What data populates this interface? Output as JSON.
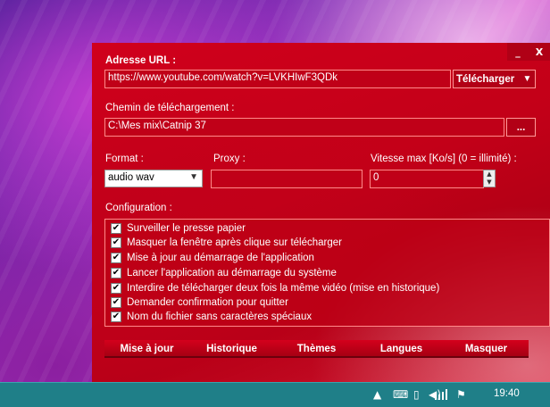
{
  "window": {
    "minimize_label": "_",
    "close_label": "X"
  },
  "url": {
    "label": "Adresse URL :",
    "value": "https://www.youtube.com/watch?v=LVKHIwF3QDk",
    "download_label": "Télécharger",
    "dropdown_arrow": "▼"
  },
  "path": {
    "label": "Chemin de téléchargement :",
    "value": "C:\\Mes mix\\Catnip 37",
    "browse_label": "..."
  },
  "format": {
    "label": "Format :",
    "selected": "audio wav"
  },
  "proxy": {
    "label": "Proxy :",
    "value": ""
  },
  "speed": {
    "label": "Vitesse max [Ko/s] (0 = illimité) :",
    "value": "0"
  },
  "config": {
    "label": "Configuration :",
    "options": [
      {
        "label": "Surveiller le presse papier",
        "checked": true
      },
      {
        "label": "Masquer la fenêtre après clique sur télécharger",
        "checked": true
      },
      {
        "label": "Mise à jour au démarrage de l'application",
        "checked": true
      },
      {
        "label": "Lancer l'application au démarrage du système",
        "checked": true
      },
      {
        "label": "Interdire de télécharger deux fois la même vidéo (mise en historique)",
        "checked": true
      },
      {
        "label": "Demander confirmation pour quitter",
        "checked": true
      },
      {
        "label": "Nom du fichier sans caractères spéciaux",
        "checked": true
      }
    ]
  },
  "bottom": {
    "update": "Mise à jour",
    "history": "Historique",
    "themes": "Thèmes",
    "languages": "Langues",
    "hide": "Masquer"
  },
  "taskbar": {
    "clock": "19:40",
    "icons": [
      "keyboard-icon",
      "speaker-icon",
      "battery-icon",
      "signal-icon",
      "flag-icon"
    ]
  },
  "colors": {
    "window_red": "#c30018",
    "taskbar_teal": "#1f7f88"
  }
}
